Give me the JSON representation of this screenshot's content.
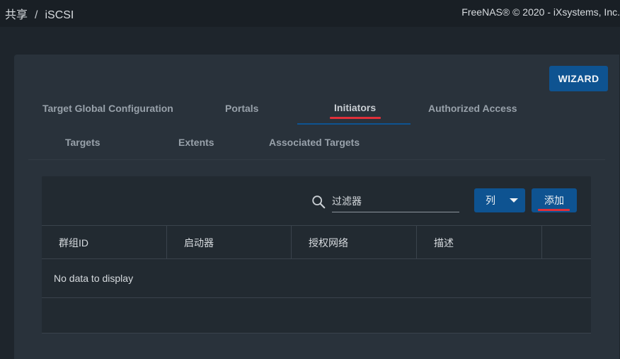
{
  "header": {
    "breadcrumb": [
      "共享",
      "iSCSI"
    ],
    "breadcrumb_separator": "/",
    "copyright": "FreeNAS® © 2020 - iXsystems, Inc."
  },
  "wizard_label": "WIZARD",
  "tabs": [
    {
      "label": "Target Global Configuration",
      "active": false
    },
    {
      "label": "Portals",
      "active": false
    },
    {
      "label": "Initiators",
      "active": true
    },
    {
      "label": "Authorized Access",
      "active": false
    },
    {
      "label": "Targets",
      "active": false
    },
    {
      "label": "Extents",
      "active": false
    },
    {
      "label": "Associated Targets",
      "active": false
    }
  ],
  "toolbar": {
    "search_icon": "search-icon",
    "filter_placeholder": "过滤器",
    "columns_label": "列",
    "columns_icon": "caret-down-icon",
    "add_label": "添加"
  },
  "table": {
    "columns": [
      "群组ID",
      "启动器",
      "授权网络",
      "描述"
    ],
    "empty_message": "No data to display"
  },
  "colors": {
    "accent": "#0e5391",
    "highlight_underline": "#e0303a",
    "background": "#1e252c",
    "card": "#29323b"
  }
}
